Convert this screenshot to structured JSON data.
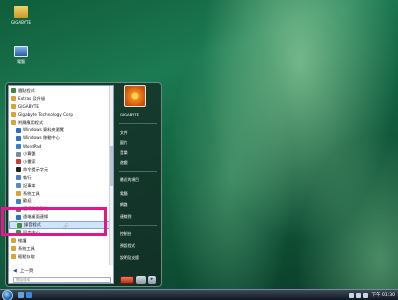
{
  "desktop": {
    "icons": [
      {
        "label": "GIGABYTE",
        "icon": "folder-icon"
      },
      {
        "label": "電腦",
        "icon": "computer-icon"
      }
    ]
  },
  "start_menu": {
    "programs": [
      {
        "label": "隨貼程式",
        "color": "#3a8a3a",
        "indent": false
      },
      {
        "label": "Extras 及升級",
        "color": "#d9a23a",
        "indent": false
      },
      {
        "label": "GIGABYTE",
        "color": "#d9a23a",
        "indent": false
      },
      {
        "label": "Gigabyte Technology Corp",
        "color": "#d9a23a",
        "indent": false
      },
      {
        "label": "附屬應用程式",
        "color": "#d9a23a",
        "indent": false
      },
      {
        "label": "Windows 資料夾瀏覽",
        "color": "#2d6fc0",
        "indent": true
      },
      {
        "label": "Windows 移動中心",
        "color": "#2d6fc0",
        "indent": true
      },
      {
        "label": "WordPad",
        "color": "#3d7bd1",
        "indent": true
      },
      {
        "label": "小算盤",
        "color": "#7c8a9a",
        "indent": true
      },
      {
        "label": "小畫家",
        "color": "#cc3b3b",
        "indent": true
      },
      {
        "label": "命令提示字元",
        "color": "#222222",
        "indent": true
      },
      {
        "label": "執行",
        "color": "#4a7fc0",
        "indent": true
      },
      {
        "label": "記事本",
        "color": "#5c8ab5",
        "indent": true
      },
      {
        "label": "系統工具",
        "color": "#d9a23a",
        "indent": true
      },
      {
        "label": "歡迎",
        "color": "#3a82c4",
        "indent": true
      },
      {
        "label": "連線到投影機",
        "color": "#6d6d6d",
        "indent": true
      },
      {
        "label": "遠端桌面連線",
        "color": "#2d6fc0",
        "indent": true
      },
      {
        "label": "錄音程式",
        "color": "#3f8f3f",
        "indent": true
      },
      {
        "label": "同步中心",
        "color": "#3a9a3a",
        "indent": true
      },
      {
        "label": "維護",
        "color": "#d9a23a",
        "indent": false
      },
      {
        "label": "系統工具",
        "color": "#d9a23a",
        "indent": false
      },
      {
        "label": "輕鬆存取",
        "color": "#d9a23a",
        "indent": false
      }
    ],
    "selected_index": 17,
    "back_label": "上一頁",
    "search_placeholder": "開始搜尋",
    "user_items": [
      {
        "label": "GIGABYTE"
      },
      {
        "label": "文件"
      },
      {
        "label": "圖片"
      },
      {
        "label": "音樂"
      },
      {
        "label": "遊戲"
      },
      {
        "label": "最近的項目"
      },
      {
        "label": "電腦"
      },
      {
        "label": "網路"
      },
      {
        "label": "連線到"
      },
      {
        "label": "控制台"
      },
      {
        "label": "預設程式"
      },
      {
        "label": "說明及支援"
      }
    ],
    "more_arrow": "▸"
  },
  "taskbar": {
    "clock": "下午 01:30"
  },
  "colors": {
    "highlight_annotation": "#e2178a",
    "selection": "#cfe3fb"
  }
}
